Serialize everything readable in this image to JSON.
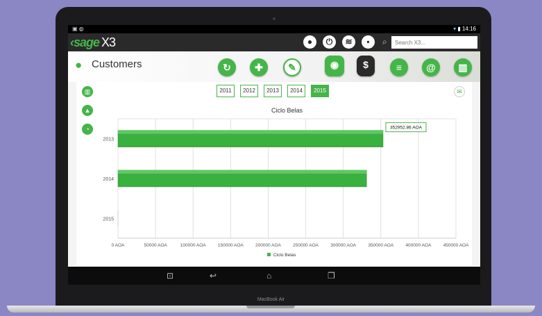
{
  "status_bar": {
    "time": "14:16"
  },
  "app": {
    "logo": "sage",
    "logo_suffix": "X3",
    "back": "‹"
  },
  "search": {
    "placeholder": "Search X3..."
  },
  "page": {
    "title": "Customers"
  },
  "years": [
    "2011",
    "2012",
    "2013",
    "2014",
    "2015"
  ],
  "selected_year": "2015",
  "device": {
    "label": "MacBook Air"
  },
  "colors": {
    "accent": "#45b549",
    "appbar": "#2a2a2a"
  },
  "chart_data": {
    "type": "bar",
    "orientation": "horizontal",
    "title": "Ciclo Belas",
    "categories": [
      "2013",
      "2014",
      "2015"
    ],
    "series": [
      {
        "name": "Ciclo Belas",
        "values": [
          352952.86,
          331000,
          0
        ]
      }
    ],
    "xlim": [
      0,
      450000
    ],
    "x_ticks": [
      "0 AOA",
      "50000 AOA",
      "100000 AOA",
      "150000 AOA",
      "200000 AOA",
      "250000 AOA",
      "300000 AOA",
      "350000 AOA",
      "400000 AOA",
      "450000 AOA"
    ],
    "tooltip": "352952.86 AOA",
    "grid": true,
    "legend_position": "bottom"
  }
}
